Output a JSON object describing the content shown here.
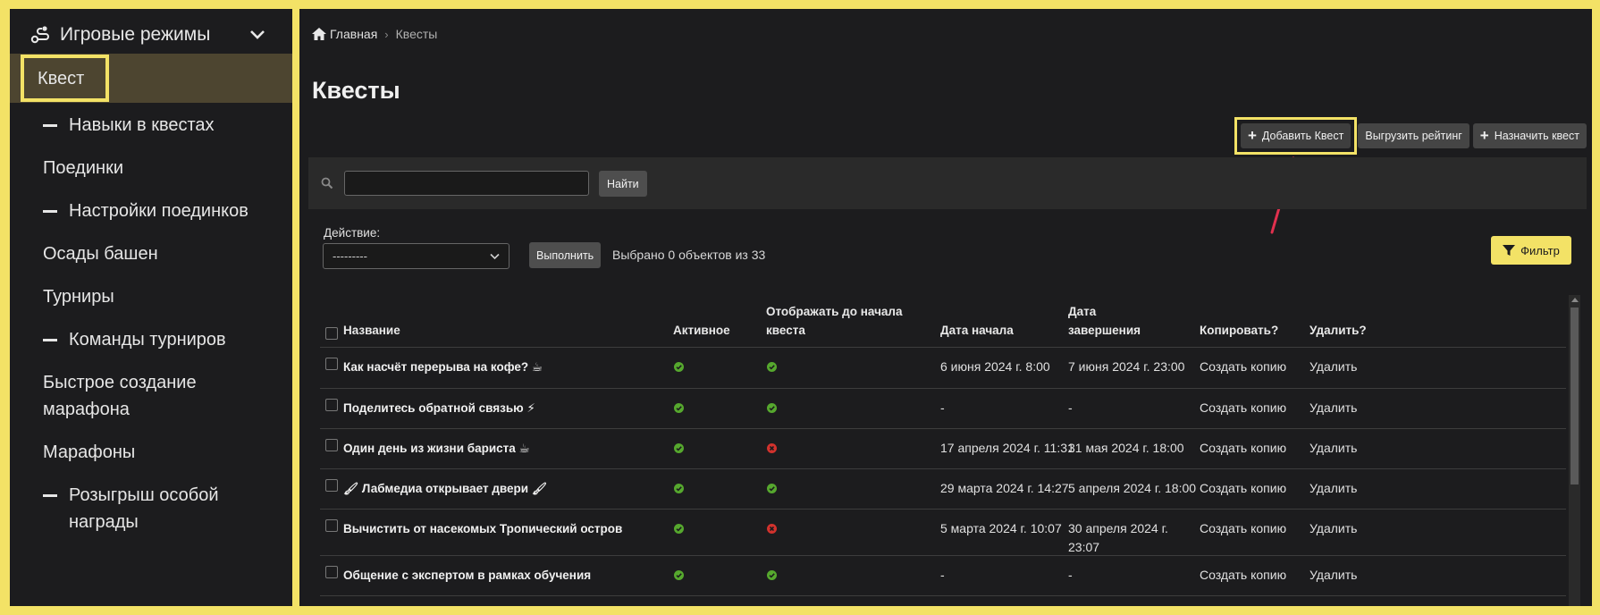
{
  "sidebar": {
    "header": "Игровые режимы",
    "items": [
      {
        "label": "Квест",
        "active": true,
        "sub": false
      },
      {
        "label": "Навыки в квестах",
        "sub": true
      },
      {
        "label": "Поединки",
        "sub": false
      },
      {
        "label": "Настройки поединков",
        "sub": true
      },
      {
        "label": "Осады башен",
        "sub": false
      },
      {
        "label": "Турниры",
        "sub": false
      },
      {
        "label": "Команды турниров",
        "sub": true
      },
      {
        "label": "Быстрое создание марафона",
        "sub": false
      },
      {
        "label": "Марафоны",
        "sub": false
      },
      {
        "label": "Розыгрыш особой награды",
        "sub": true
      }
    ]
  },
  "breadcrumb": {
    "home": "Главная",
    "current": "Квесты"
  },
  "page_title": "Квесты",
  "buttons": {
    "add_quest": "Добавить Квест",
    "export_rating": "Выгрузить рейтинг",
    "assign_quest": "Назначить квест",
    "find": "Найти",
    "run": "Выполнить",
    "filter": "Фильтр"
  },
  "search": {
    "value": ""
  },
  "actions": {
    "label": "Действие:",
    "selected": "---------",
    "selection_count": "Выбрано 0 объектов из 33"
  },
  "table": {
    "headers": {
      "name": "Название",
      "active": "Активное",
      "show_before_1": "Отображать до начала",
      "show_before_2": "квеста",
      "start": "Дата начала",
      "end_1": "Дата",
      "end_2": "завершения",
      "copy": "Копировать?",
      "delete": "Удалить?"
    },
    "rows": [
      {
        "name": "Как насчёт перерыва на кофе? ☕",
        "active": true,
        "show": true,
        "start": "6 июня 2024 г. 8:00",
        "end": "7 июня 2024 г. 23:00",
        "copy": "Создать копию",
        "delete": "Удалить"
      },
      {
        "name": "Поделитесь обратной связью ⚡",
        "active": true,
        "show": true,
        "start": "-",
        "end": "-",
        "copy": "Создать копию",
        "delete": "Удалить"
      },
      {
        "name": "Один день из жизни бариста ☕",
        "active": true,
        "show": false,
        "start": "17 апреля 2024 г. 11:31",
        "end": "31 мая 2024 г. 18:00",
        "copy": "Создать копию",
        "delete": "Удалить"
      },
      {
        "name": "🖌 Лабмедиа открывает двери 🖌",
        "active": true,
        "show": true,
        "start": "29 марта 2024 г. 14:27",
        "end": "5 апреля 2024 г. 18:00",
        "copy": "Создать копию",
        "delete": "Удалить"
      },
      {
        "name": "Вычистить от насекомых Тропический остров",
        "active": true,
        "show": false,
        "start": "5 марта 2024 г. 10:07",
        "end": "30 апреля 2024 г. 23:07",
        "copy": "Создать копию",
        "delete": "Удалить"
      },
      {
        "name": "Общение с экспертом в рамках обучения",
        "active": true,
        "show": true,
        "start": "-",
        "end": "-",
        "copy": "Создать копию",
        "delete": "Удалить"
      }
    ]
  },
  "colors": {
    "accent": "#f3e266",
    "active_bg": "#4d4530",
    "check_green": "#56a82e",
    "cross_red": "#d2322d",
    "arrow": "#e0304e"
  }
}
